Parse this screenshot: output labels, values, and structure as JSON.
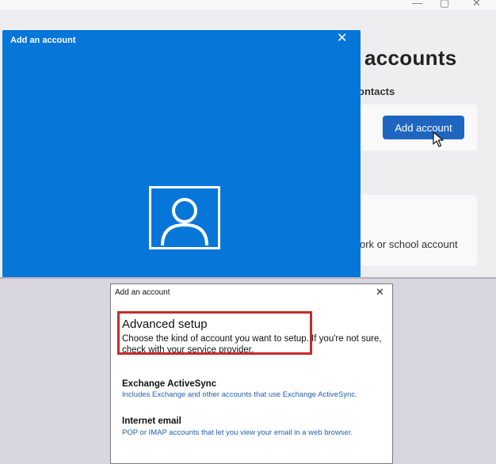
{
  "background_window": {
    "title_partial": "accounts",
    "section_partial": "ontacts",
    "add_account_label": "Add account",
    "work_account_partial": "ork or school account"
  },
  "blue_dialog": {
    "title": "Add an account",
    "close_glyph": "✕"
  },
  "classic_dialog": {
    "title": "Add an account",
    "close_glyph": "✕",
    "heading": "Advanced setup",
    "description": "Choose the kind of account you want to setup. If you're not sure, check with your service provider.",
    "options": [
      {
        "title": "Exchange ActiveSync",
        "description": "Includes Exchange and other accounts that use Exchange ActiveSync."
      },
      {
        "title": "Internet email",
        "description": "POP or IMAP accounts that let you view your email in a web browser."
      }
    ]
  },
  "colors": {
    "accent_blue": "#0676d9",
    "button_blue": "#1f66c1",
    "highlight_red": "#c62b2b",
    "link_blue": "#1f5fa8"
  }
}
